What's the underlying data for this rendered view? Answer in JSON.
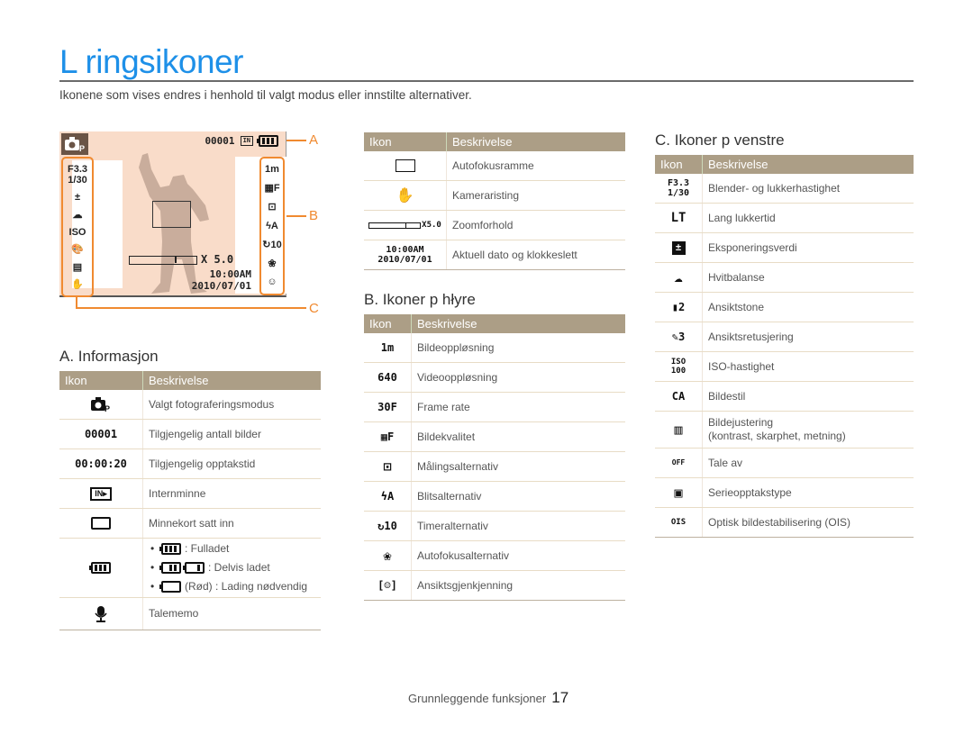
{
  "page": {
    "title": "L ringsikoner",
    "intro": "Ikonene som vises endres i henhold til valgt modus eller innstilte alternativer."
  },
  "illustration": {
    "mode_icon": "camera-program-mode-icon",
    "mode_text": "P",
    "shots_remaining": "00001",
    "memory_label": "IN",
    "aperture": "F3.3",
    "shutter": "1/30",
    "zoom": "X 5.0",
    "time": "10:00AM",
    "date": "2010/07/01",
    "callouts": [
      "A",
      "B",
      "C"
    ],
    "left_icons": [
      "F3.3 1/30",
      "±",
      "☁",
      "ISO",
      "🎨",
      "▤",
      "✋"
    ],
    "right_icons": [
      "1m",
      "▦F",
      "⊡",
      "ϟA",
      "↻10",
      "❀",
      "☺"
    ]
  },
  "section_a": {
    "heading": "A. Informasjon",
    "col_icon": "Ikon",
    "col_desc": "Beskrivelse",
    "rows": [
      {
        "icon": "camera-mode-icon",
        "glyph": "📷P",
        "desc": "Valgt fotograferingsmodus"
      },
      {
        "icon": "shot-counter-icon",
        "glyph": "00001",
        "desc": "Tilgjengelig antall bilder"
      },
      {
        "icon": "record-time-icon",
        "glyph": "00:00:20",
        "desc": "Tilgjengelig opptakstid"
      },
      {
        "icon": "internal-memory-icon",
        "glyph": "IN▸",
        "desc": "Internminne"
      },
      {
        "icon": "memory-card-icon",
        "glyph": "▭▸",
        "desc": "Minnekort satt inn"
      },
      {
        "icon": "battery-icon",
        "glyph": "",
        "desc": "",
        "bullets": [
          {
            "text": ": Fulladet"
          },
          {
            "text": ": Delvis ladet"
          },
          {
            "text": "(Rød) : Lading nødvendig"
          }
        ]
      },
      {
        "icon": "voice-memo-icon",
        "glyph": "🎙",
        "desc": "Talememo"
      }
    ]
  },
  "section_top": {
    "col_icon": "Ikon",
    "col_desc": "Beskrivelse",
    "rows": [
      {
        "icon": "autofocus-frame-icon",
        "glyph": "",
        "desc": "Autofokusramme"
      },
      {
        "icon": "camera-shake-icon",
        "glyph": "✋",
        "desc": "Kameraristing"
      },
      {
        "icon": "zoom-ratio-icon",
        "glyph": "X5.0",
        "desc": "Zoomforhold"
      },
      {
        "icon": "date-time-icon",
        "glyph": "10:00AM 2010/07/01",
        "desc": "Aktuell dato og klokkeslett"
      }
    ]
  },
  "section_b": {
    "heading": "B. Ikoner p  hłyre",
    "col_icon": "Ikon",
    "col_desc": "Beskrivelse",
    "rows": [
      {
        "icon": "photo-resolution-icon",
        "glyph": "1m",
        "desc": "Bildeoppløsning"
      },
      {
        "icon": "video-resolution-icon",
        "glyph": "640",
        "desc": "Videooppløsning"
      },
      {
        "icon": "frame-rate-icon",
        "glyph": "30F",
        "desc": "Frame rate"
      },
      {
        "icon": "image-quality-icon",
        "glyph": "▦F",
        "desc": "Bildekvalitet"
      },
      {
        "icon": "metering-icon",
        "glyph": "⊡",
        "desc": "Målingsalternativ"
      },
      {
        "icon": "flash-auto-icon",
        "glyph": "ϟA",
        "desc": "Blitsalternativ"
      },
      {
        "icon": "timer-icon",
        "glyph": "↻10",
        "desc": "Timeralternativ"
      },
      {
        "icon": "macro-focus-icon",
        "glyph": "❀",
        "desc": "Autofokusalternativ"
      },
      {
        "icon": "face-detection-icon",
        "glyph": "[☺]",
        "desc": "Ansiktsgjenkjenning"
      }
    ]
  },
  "section_c": {
    "heading": "C. Ikoner p  venstre",
    "col_icon": "Ikon",
    "col_desc": "Beskrivelse",
    "rows": [
      {
        "icon": "aperture-shutter-icon",
        "glyph": "F3.3 1/30",
        "desc": "Blender- og lukkerhastighet"
      },
      {
        "icon": "long-time-icon",
        "glyph": "LT",
        "desc": "Lang lukkertid"
      },
      {
        "icon": "exposure-value-icon",
        "glyph": "±",
        "desc": "Eksponeringsverdi"
      },
      {
        "icon": "white-balance-icon",
        "glyph": "☁",
        "desc": "Hvitbalanse"
      },
      {
        "icon": "face-tone-icon",
        "glyph": "▮2",
        "desc": "Ansiktstone"
      },
      {
        "icon": "face-retouch-icon",
        "glyph": "✎3",
        "desc": "Ansiktsretusjering"
      },
      {
        "icon": "iso-icon",
        "glyph": "ISO 100",
        "desc": "ISO-hastighet"
      },
      {
        "icon": "photo-style-icon",
        "glyph": "CA",
        "desc": "Bildestil"
      },
      {
        "icon": "image-adjust-icon",
        "glyph": "▥",
        "desc": "Bildejustering",
        "desc2": "(kontrast, skarphet, metning)"
      },
      {
        "icon": "voice-off-icon",
        "glyph": "OFF",
        "desc": "Tale av"
      },
      {
        "icon": "burst-mode-icon",
        "glyph": "▣",
        "desc": "Serieopptakstype"
      },
      {
        "icon": "ois-icon",
        "glyph": "OIS",
        "desc": "Optisk bildestabilisering (OIS)"
      }
    ]
  },
  "footer": {
    "section": "Grunnleggende funksjoner",
    "page_number": "17"
  }
}
